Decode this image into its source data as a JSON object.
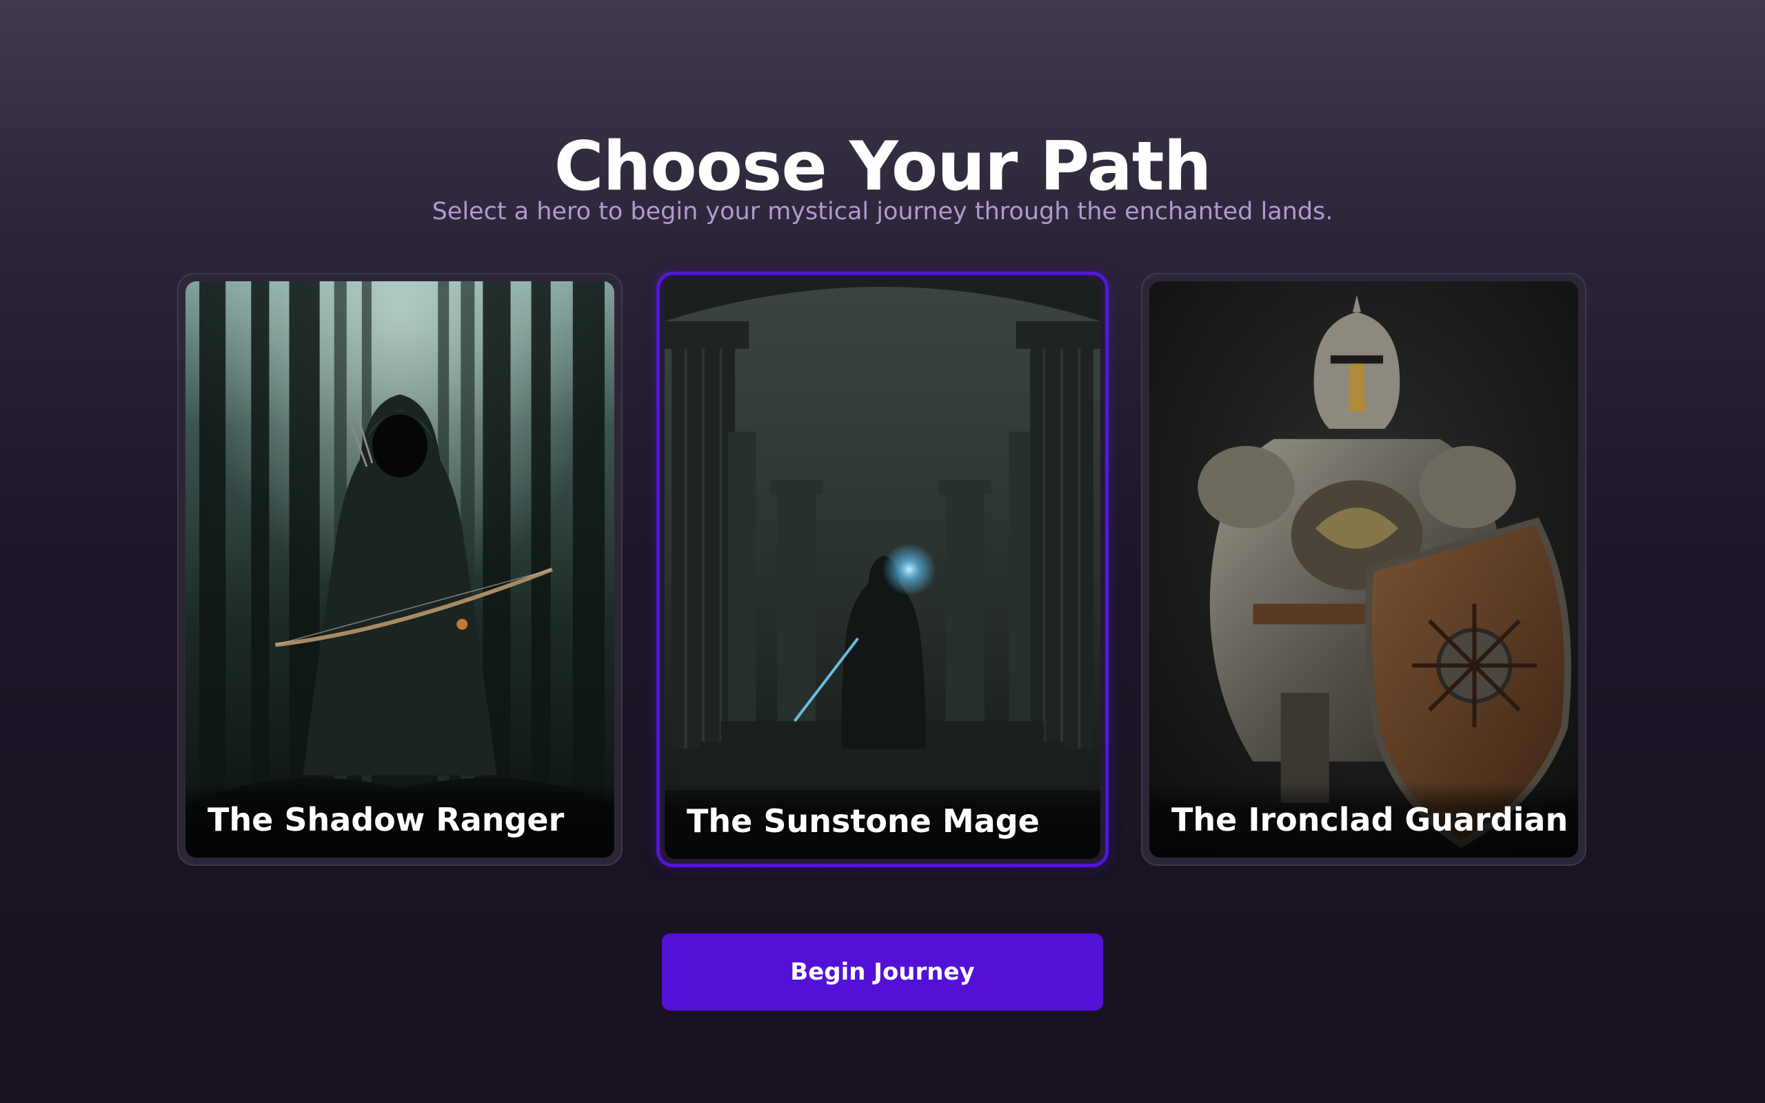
{
  "header": {
    "title": "Choose Your Path",
    "subtitle": "Select a hero to begin your mystical journey through the enchanted lands."
  },
  "heroes": [
    {
      "name": "The Shadow Ranger",
      "image": "hooded-archer-in-forest",
      "selected": false
    },
    {
      "name": "The Sunstone Mage",
      "image": "mage-among-ruined-pillars",
      "selected": true
    },
    {
      "name": "The Ironclad Guardian",
      "image": "armored-knight-with-shield",
      "selected": false
    }
  ],
  "actions": {
    "begin_label": "Begin Journey"
  },
  "colors": {
    "accent": "#5311d8",
    "subtitle": "#b09ad2",
    "card_border": "#3f374c"
  }
}
